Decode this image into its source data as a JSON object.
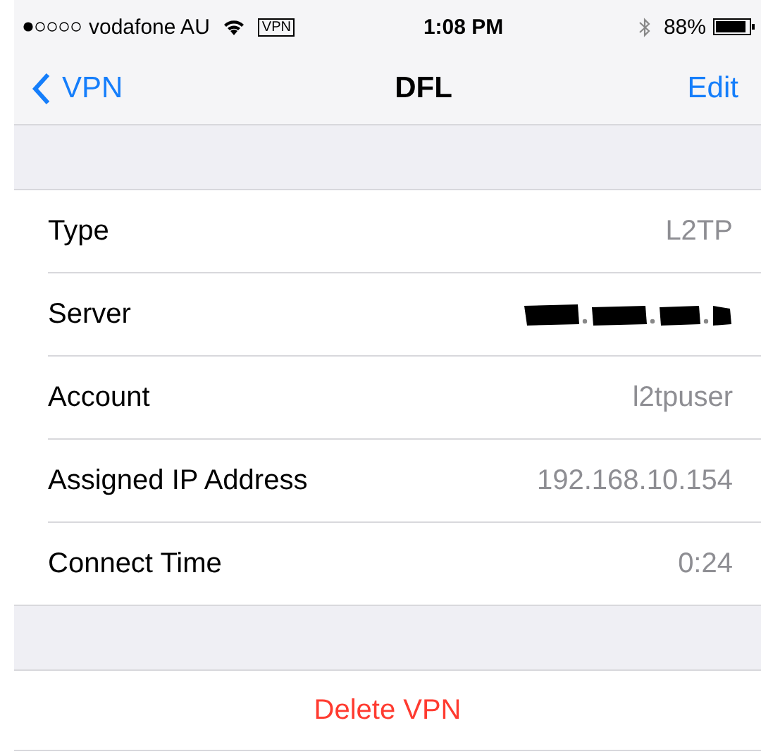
{
  "status_bar": {
    "carrier": "vodafone AU",
    "vpn_badge": "VPN",
    "time": "1:08 PM",
    "battery": "88%"
  },
  "nav": {
    "back": "VPN",
    "title": "DFL",
    "action": "Edit"
  },
  "rows": [
    {
      "label": "Type",
      "value": "L2TP",
      "kind": "text"
    },
    {
      "label": "Server",
      "kind": "redacted"
    },
    {
      "label": "Account",
      "value": "l2tpuser",
      "kind": "text"
    },
    {
      "label": "Assigned IP Address",
      "value": "192.168.10.154",
      "kind": "text"
    },
    {
      "label": "Connect Time",
      "value": "0:24",
      "kind": "text"
    }
  ],
  "delete_button": "Delete VPN"
}
